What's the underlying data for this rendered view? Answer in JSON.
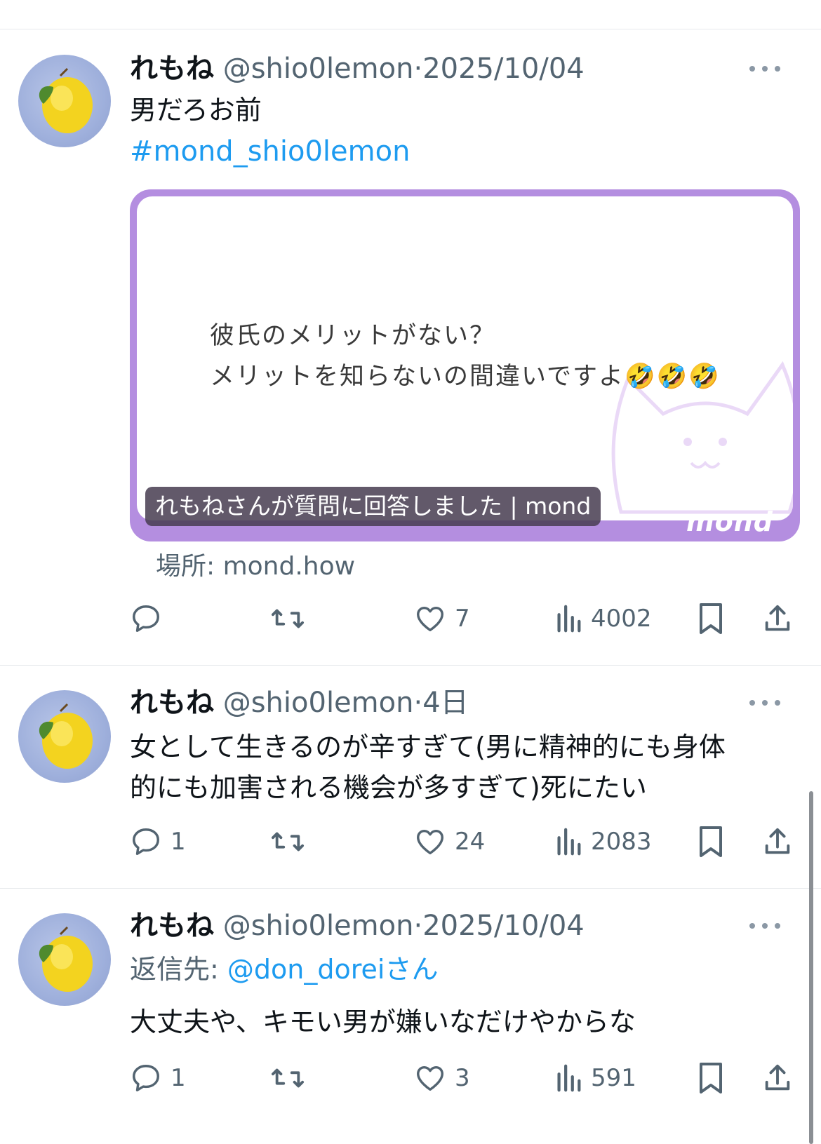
{
  "tweets": [
    {
      "name": "れもね",
      "handle": "@shio0lemon",
      "separator": "·",
      "date": "2025/10/04",
      "text": "男だろお前",
      "hashtag": "#mond_shio0lemon",
      "card": {
        "line1": "彼氏のメリットがない？",
        "line2": "メリットを知らないの間違いですよ🤣🤣🤣",
        "caption": "れもねさんが質問に回答しました | mond",
        "logo": "mond"
      },
      "location": "場所: mond.how",
      "reply_count": "",
      "retweet_count": "",
      "like_count": "7",
      "view_count": "4002"
    },
    {
      "name": "れもね",
      "handle": "@shio0lemon",
      "separator": "·",
      "date": "4日",
      "text_line1": "女として生きるのが辛すぎて(男に精神的にも身体",
      "text_line2": "的にも加害される機会が多すぎて)死にたい",
      "reply_count": "1",
      "retweet_count": "",
      "like_count": "24",
      "view_count": "2083"
    },
    {
      "name": "れもね",
      "handle": "@shio0lemon",
      "separator": "·",
      "date": "2025/10/04",
      "replying_label": "返信先:",
      "replying_to": "@don_dorei",
      "replying_suffix": "さん",
      "text": "大丈夫や、キモい男が嫌いなだけやからな",
      "reply_count": "1",
      "retweet_count": "",
      "like_count": "3",
      "view_count": "591"
    }
  ],
  "icons": {
    "avatar": "lemon-avatar",
    "more": "more-icon",
    "reply": "reply-icon",
    "retweet": "retweet-icon",
    "like": "heart-icon",
    "views": "views-icon",
    "bookmark": "bookmark-icon",
    "share": "share-icon"
  },
  "colors": {
    "link": "#1d9bf0",
    "secondary_text": "#536471",
    "card_border": "#b48ee0"
  }
}
